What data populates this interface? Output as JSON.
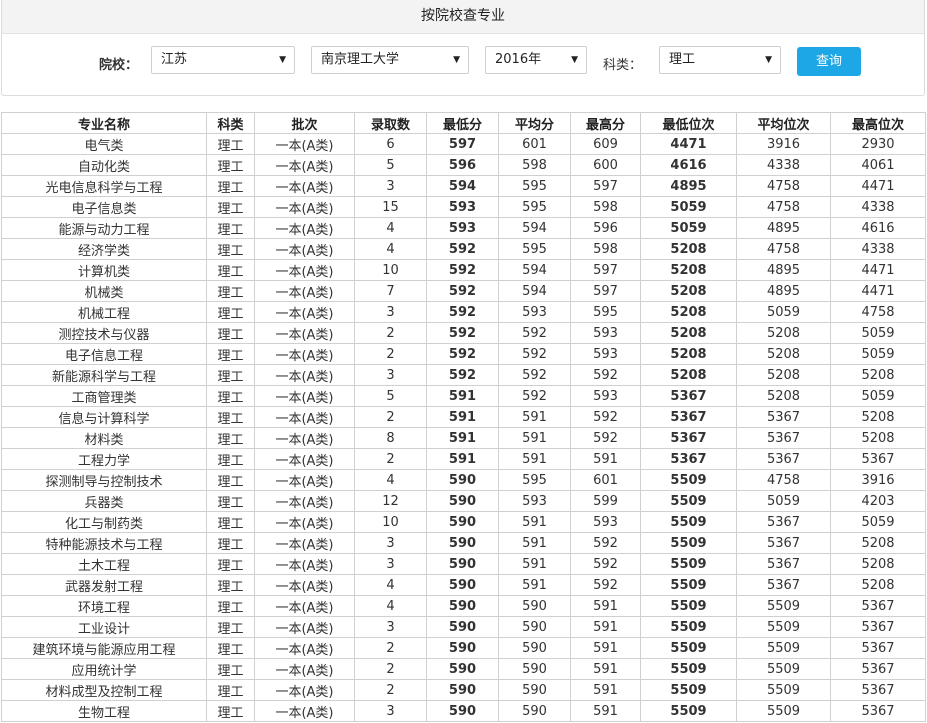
{
  "header": {
    "title": "按院校查专业"
  },
  "filters": {
    "school_label": "院校：",
    "province": "江苏",
    "university": "南京理工大学",
    "year": "2016年",
    "subject_label": "科类：",
    "subject": "理工",
    "query_button": "查询"
  },
  "colors": {
    "accent": "#1ea7e7",
    "highlight": "#ee6a22"
  },
  "table": {
    "columns": [
      "专业名称",
      "科类",
      "批次",
      "录取数",
      "最低分",
      "平均分",
      "最高分",
      "最低位次",
      "平均位次",
      "最高位次"
    ],
    "rows": [
      [
        "电气类",
        "理工",
        "一本(A类)",
        "6",
        "597",
        "601",
        "609",
        "4471",
        "3916",
        "2930"
      ],
      [
        "自动化类",
        "理工",
        "一本(A类)",
        "5",
        "596",
        "598",
        "600",
        "4616",
        "4338",
        "4061"
      ],
      [
        "光电信息科学与工程",
        "理工",
        "一本(A类)",
        "3",
        "594",
        "595",
        "597",
        "4895",
        "4758",
        "4471"
      ],
      [
        "电子信息类",
        "理工",
        "一本(A类)",
        "15",
        "593",
        "595",
        "598",
        "5059",
        "4758",
        "4338"
      ],
      [
        "能源与动力工程",
        "理工",
        "一本(A类)",
        "4",
        "593",
        "594",
        "596",
        "5059",
        "4895",
        "4616"
      ],
      [
        "经济学类",
        "理工",
        "一本(A类)",
        "4",
        "592",
        "595",
        "598",
        "5208",
        "4758",
        "4338"
      ],
      [
        "计算机类",
        "理工",
        "一本(A类)",
        "10",
        "592",
        "594",
        "597",
        "5208",
        "4895",
        "4471"
      ],
      [
        "机械类",
        "理工",
        "一本(A类)",
        "7",
        "592",
        "594",
        "597",
        "5208",
        "4895",
        "4471"
      ],
      [
        "机械工程",
        "理工",
        "一本(A类)",
        "3",
        "592",
        "593",
        "595",
        "5208",
        "5059",
        "4758"
      ],
      [
        "测控技术与仪器",
        "理工",
        "一本(A类)",
        "2",
        "592",
        "592",
        "593",
        "5208",
        "5208",
        "5059"
      ],
      [
        "电子信息工程",
        "理工",
        "一本(A类)",
        "2",
        "592",
        "592",
        "593",
        "5208",
        "5208",
        "5059"
      ],
      [
        "新能源科学与工程",
        "理工",
        "一本(A类)",
        "3",
        "592",
        "592",
        "592",
        "5208",
        "5208",
        "5208"
      ],
      [
        "工商管理类",
        "理工",
        "一本(A类)",
        "5",
        "591",
        "592",
        "593",
        "5367",
        "5208",
        "5059"
      ],
      [
        "信息与计算科学",
        "理工",
        "一本(A类)",
        "2",
        "591",
        "591",
        "592",
        "5367",
        "5367",
        "5208"
      ],
      [
        "材料类",
        "理工",
        "一本(A类)",
        "8",
        "591",
        "591",
        "592",
        "5367",
        "5367",
        "5208"
      ],
      [
        "工程力学",
        "理工",
        "一本(A类)",
        "2",
        "591",
        "591",
        "591",
        "5367",
        "5367",
        "5367"
      ],
      [
        "探测制导与控制技术",
        "理工",
        "一本(A类)",
        "4",
        "590",
        "595",
        "601",
        "5509",
        "4758",
        "3916"
      ],
      [
        "兵器类",
        "理工",
        "一本(A类)",
        "12",
        "590",
        "593",
        "599",
        "5509",
        "5059",
        "4203"
      ],
      [
        "化工与制药类",
        "理工",
        "一本(A类)",
        "10",
        "590",
        "591",
        "593",
        "5509",
        "5367",
        "5059"
      ],
      [
        "特种能源技术与工程",
        "理工",
        "一本(A类)",
        "3",
        "590",
        "591",
        "592",
        "5509",
        "5367",
        "5208"
      ],
      [
        "土木工程",
        "理工",
        "一本(A类)",
        "3",
        "590",
        "591",
        "592",
        "5509",
        "5367",
        "5208"
      ],
      [
        "武器发射工程",
        "理工",
        "一本(A类)",
        "4",
        "590",
        "591",
        "592",
        "5509",
        "5367",
        "5208"
      ],
      [
        "环境工程",
        "理工",
        "一本(A类)",
        "4",
        "590",
        "590",
        "591",
        "5509",
        "5509",
        "5367"
      ],
      [
        "工业设计",
        "理工",
        "一本(A类)",
        "3",
        "590",
        "590",
        "591",
        "5509",
        "5509",
        "5367"
      ],
      [
        "建筑环境与能源应用工程",
        "理工",
        "一本(A类)",
        "2",
        "590",
        "590",
        "591",
        "5509",
        "5509",
        "5367"
      ],
      [
        "应用统计学",
        "理工",
        "一本(A类)",
        "2",
        "590",
        "590",
        "591",
        "5509",
        "5509",
        "5367"
      ],
      [
        "材料成型及控制工程",
        "理工",
        "一本(A类)",
        "2",
        "590",
        "590",
        "591",
        "5509",
        "5509",
        "5367"
      ],
      [
        "生物工程",
        "理工",
        "一本(A类)",
        "3",
        "590",
        "590",
        "591",
        "5509",
        "5509",
        "5367"
      ]
    ]
  }
}
